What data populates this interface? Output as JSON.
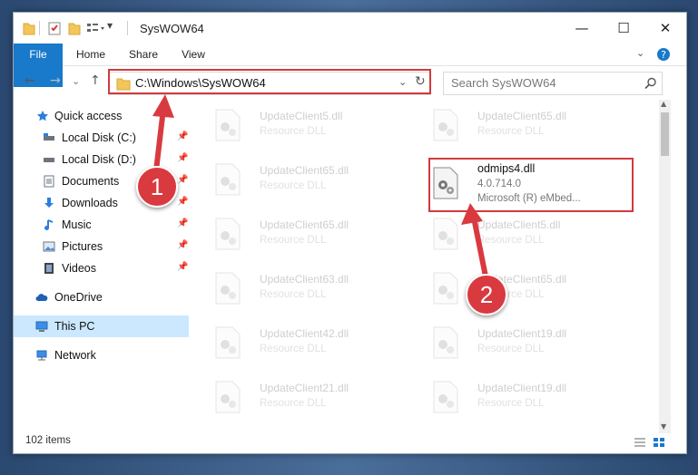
{
  "window": {
    "title": "SysWOW64"
  },
  "ribbon": {
    "tabs": [
      "File",
      "Home",
      "Share",
      "View"
    ]
  },
  "nav": {
    "address": "C:\\Windows\\SysWOW64",
    "search_placeholder": "Search SysWOW64"
  },
  "sidebar": {
    "items": [
      {
        "label": "Quick access",
        "icon": "star-icon"
      },
      {
        "label": "Local Disk (C:)",
        "icon": "drive-icon"
      },
      {
        "label": "Local Disk (D:)",
        "icon": "drive-icon"
      },
      {
        "label": "Documents",
        "icon": "documents-icon"
      },
      {
        "label": "Downloads",
        "icon": "download-icon"
      },
      {
        "label": "Music",
        "icon": "music-icon"
      },
      {
        "label": "Pictures",
        "icon": "pictures-icon"
      },
      {
        "label": "Videos",
        "icon": "videos-icon"
      },
      {
        "label": "OneDrive",
        "icon": "cloud-icon"
      },
      {
        "label": "This PC",
        "icon": "computer-icon"
      },
      {
        "label": "Network",
        "icon": "network-icon"
      }
    ]
  },
  "files": {
    "left": [
      {
        "name": "UpdateClient5.dll",
        "desc": "Resource DLL"
      },
      {
        "name": "UpdateClient65.dll",
        "desc": "Resource DLL"
      },
      {
        "name": "UpdateClient65.dll",
        "desc": "Resource DLL"
      },
      {
        "name": "UpdateClient63.dll",
        "desc": "Resource DLL"
      },
      {
        "name": "UpdateClient42.dll",
        "desc": "Resource DLL"
      },
      {
        "name": "UpdateClient21.dll",
        "desc": "Resource DLL"
      }
    ],
    "right": [
      {
        "name": "UpdateClient65.dll",
        "desc": "Resource DLL"
      },
      {
        "name": "odmips4.dll",
        "desc": "4.0.714.0",
        "desc2": "Microsoft (R) eMbed..."
      },
      {
        "name": "UpdateClient5.dll",
        "desc": "Resource DLL"
      },
      {
        "name": "UpdateClient65.dll",
        "desc": "Resource DLL"
      },
      {
        "name": "UpdateClient19.dll",
        "desc": "Resource DLL"
      },
      {
        "name": "UpdateClient19.dll",
        "desc": "Resource DLL"
      }
    ]
  },
  "status": {
    "count": "102 items"
  },
  "annotations": {
    "marker1": "1",
    "marker2": "2"
  },
  "colors": {
    "accent": "#1979ca",
    "highlight": "#d23a3e",
    "selected": "#cce8ff"
  }
}
